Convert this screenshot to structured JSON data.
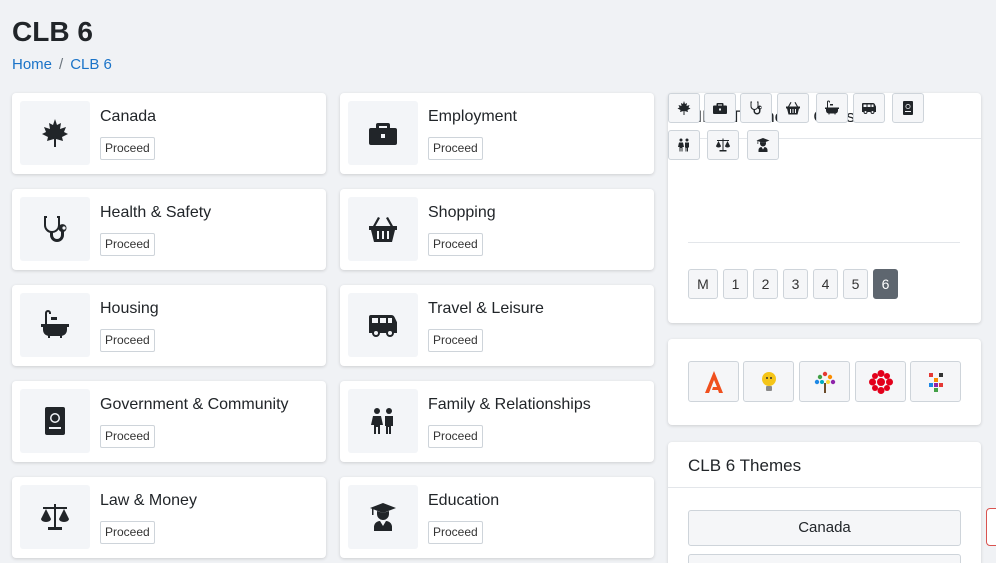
{
  "page": {
    "title": "CLB 6"
  },
  "breadcrumb": {
    "home": "Home",
    "separator": "/",
    "current": "CLB 6"
  },
  "themes": [
    {
      "title": "Canada",
      "icon": "maple-leaf-icon",
      "action": "Proceed"
    },
    {
      "title": "Employment",
      "icon": "briefcase-icon",
      "action": "Proceed"
    },
    {
      "title": "Health & Safety",
      "icon": "stethoscope-icon",
      "action": "Proceed"
    },
    {
      "title": "Shopping",
      "icon": "shopping-basket-icon",
      "action": "Proceed"
    },
    {
      "title": "Housing",
      "icon": "bath-icon",
      "action": "Proceed"
    },
    {
      "title": "Travel & Leisure",
      "icon": "van-icon",
      "action": "Proceed"
    },
    {
      "title": "Government & Community",
      "icon": "passport-icon",
      "action": "Proceed"
    },
    {
      "title": "Family & Relationships",
      "icon": "family-icon",
      "action": "Proceed"
    },
    {
      "title": "Law & Money",
      "icon": "balance-scale-icon",
      "action": "Proceed"
    },
    {
      "title": "Education",
      "icon": "graduate-icon",
      "action": "Proceed"
    }
  ],
  "linc_panel": {
    "title": "LINC Themes & CLBs",
    "theme_icons": [
      "maple-leaf-icon",
      "briefcase-icon",
      "stethoscope-icon",
      "shopping-basket-icon",
      "bath-icon",
      "van-icon",
      "passport-icon",
      "family-icon",
      "balance-scale-icon",
      "graduate-icon"
    ],
    "levels": [
      "M",
      "1",
      "2",
      "3",
      "4",
      "5",
      "6"
    ],
    "active_level": "6"
  },
  "resources_panel": {
    "links": [
      "a-logo-icon",
      "lightbulb-icon",
      "tree-logo-icon",
      "cbc-gem-icon",
      "pixel-logo-icon"
    ]
  },
  "clb_themes_panel": {
    "title": "CLB 6 Themes",
    "items": [
      "Canada"
    ]
  },
  "colors": {
    "link": "#1a73c8",
    "active_level": "#5e666f",
    "icon": "#212529",
    "a_logo": "#f0501e",
    "cbc": "#e3001b"
  }
}
